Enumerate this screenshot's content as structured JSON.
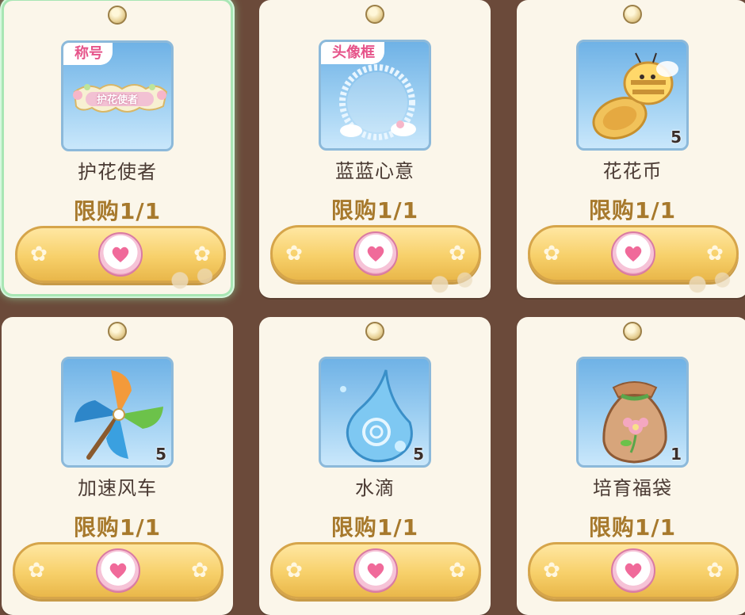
{
  "colors": {
    "background": "#6b4a3a",
    "card": "#fbf6ea",
    "limit_text": "#a7792c",
    "buy_button": "#f7d06a",
    "selected_glow": "#a8e6b4",
    "tag_text": "#e6548a"
  },
  "shop": {
    "items": [
      {
        "name": "护花使者",
        "limit": "限购1/1",
        "tag": "称号",
        "banner": "护花使者",
        "count": "",
        "icon": "title-banner-icon",
        "selected": true
      },
      {
        "name": "蓝蓝心意",
        "limit": "限购1/1",
        "tag": "头像框",
        "count": "",
        "icon": "avatar-frame-icon",
        "selected": false
      },
      {
        "name": "花花币",
        "limit": "限购1/1",
        "tag": "",
        "count": "5",
        "icon": "bee-coin-icon",
        "selected": false
      },
      {
        "name": "加速风车",
        "limit": "限购1/1",
        "tag": "",
        "count": "5",
        "icon": "pinwheel-icon",
        "selected": false
      },
      {
        "name": "水滴",
        "limit": "限购1/1",
        "tag": "",
        "count": "5",
        "icon": "water-drop-icon",
        "selected": false
      },
      {
        "name": "培育福袋",
        "limit": "限购1/1",
        "tag": "",
        "count": "1",
        "icon": "seed-bag-icon",
        "selected": false
      }
    ],
    "currency_icon": "heart-coin-icon"
  }
}
